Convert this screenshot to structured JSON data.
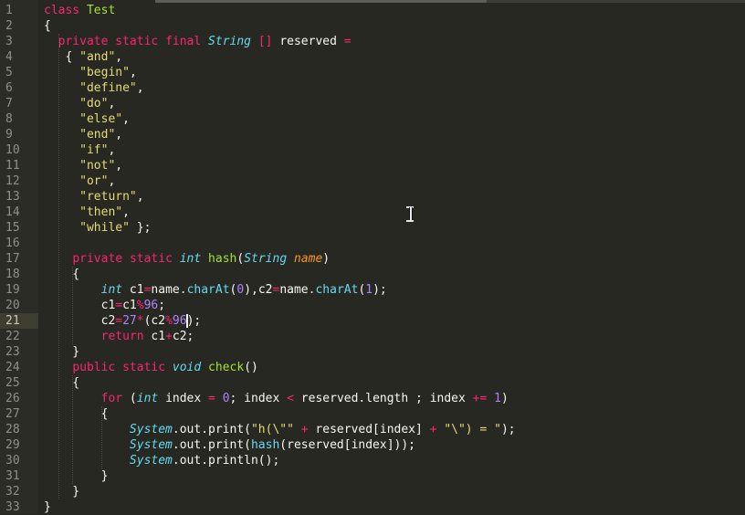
{
  "editor": {
    "theme_colors": {
      "background": "#272822",
      "keyword": "#f92672",
      "type": "#66d9ef",
      "function": "#a6e22e",
      "string": "#e6db74",
      "number": "#ae81ff",
      "parameter": "#fd971f",
      "text": "#f8f8f2",
      "line_number": "#8f908a"
    },
    "active_line": 21,
    "lines": [
      {
        "n": "1",
        "tokens": [
          [
            "kw",
            "class"
          ],
          [
            "pl",
            " "
          ],
          [
            "fn",
            "Test"
          ]
        ]
      },
      {
        "n": "2",
        "tokens": [
          [
            "pl",
            "{"
          ]
        ]
      },
      {
        "n": "3",
        "tokens": [
          [
            "pl",
            "  "
          ],
          [
            "kw",
            "private"
          ],
          [
            "pl",
            " "
          ],
          [
            "kw",
            "static"
          ],
          [
            "pl",
            " "
          ],
          [
            "kw",
            "final"
          ],
          [
            "pl",
            " "
          ],
          [
            "ty",
            "String"
          ],
          [
            "pl",
            " "
          ],
          [
            "op",
            "[]"
          ],
          [
            "pl",
            " reserved "
          ],
          [
            "op",
            "="
          ]
        ]
      },
      {
        "n": "4",
        "tokens": [
          [
            "pl",
            "   { "
          ],
          [
            "st",
            "\"and\""
          ],
          [
            "pl",
            ","
          ]
        ]
      },
      {
        "n": "5",
        "tokens": [
          [
            "pl",
            "     "
          ],
          [
            "st",
            "\"begin\""
          ],
          [
            "pl",
            ","
          ]
        ]
      },
      {
        "n": "6",
        "tokens": [
          [
            "pl",
            "     "
          ],
          [
            "st",
            "\"define\""
          ],
          [
            "pl",
            ","
          ]
        ]
      },
      {
        "n": "7",
        "tokens": [
          [
            "pl",
            "     "
          ],
          [
            "st",
            "\"do\""
          ],
          [
            "pl",
            ","
          ]
        ]
      },
      {
        "n": "8",
        "tokens": [
          [
            "pl",
            "     "
          ],
          [
            "st",
            "\"else\""
          ],
          [
            "pl",
            ","
          ]
        ]
      },
      {
        "n": "9",
        "tokens": [
          [
            "pl",
            "     "
          ],
          [
            "st",
            "\"end\""
          ],
          [
            "pl",
            ","
          ]
        ]
      },
      {
        "n": "10",
        "tokens": [
          [
            "pl",
            "     "
          ],
          [
            "st",
            "\"if\""
          ],
          [
            "pl",
            ","
          ]
        ]
      },
      {
        "n": "11",
        "tokens": [
          [
            "pl",
            "     "
          ],
          [
            "st",
            "\"not\""
          ],
          [
            "pl",
            ","
          ]
        ]
      },
      {
        "n": "12",
        "tokens": [
          [
            "pl",
            "     "
          ],
          [
            "st",
            "\"or\""
          ],
          [
            "pl",
            ","
          ]
        ]
      },
      {
        "n": "13",
        "tokens": [
          [
            "pl",
            "     "
          ],
          [
            "st",
            "\"return\""
          ],
          [
            "pl",
            ","
          ]
        ]
      },
      {
        "n": "14",
        "tokens": [
          [
            "pl",
            "     "
          ],
          [
            "st",
            "\"then\""
          ],
          [
            "pl",
            ","
          ]
        ]
      },
      {
        "n": "15",
        "tokens": [
          [
            "pl",
            "     "
          ],
          [
            "st",
            "\"while\""
          ],
          [
            "pl",
            " };"
          ]
        ]
      },
      {
        "n": "16",
        "tokens": []
      },
      {
        "n": "17",
        "tokens": [
          [
            "pl",
            "    "
          ],
          [
            "kw",
            "private"
          ],
          [
            "pl",
            " "
          ],
          [
            "kw",
            "static"
          ],
          [
            "pl",
            " "
          ],
          [
            "ty",
            "int"
          ],
          [
            "pl",
            " "
          ],
          [
            "fn",
            "hash"
          ],
          [
            "pl",
            "("
          ],
          [
            "ty",
            "String"
          ],
          [
            "pl",
            " "
          ],
          [
            "pa",
            "name"
          ],
          [
            "pl",
            ")"
          ]
        ]
      },
      {
        "n": "18",
        "tokens": [
          [
            "pl",
            "    {"
          ]
        ]
      },
      {
        "n": "19",
        "tokens": [
          [
            "pl",
            "        "
          ],
          [
            "ty",
            "int"
          ],
          [
            "pl",
            " c1"
          ],
          [
            "op",
            "="
          ],
          [
            "pl",
            "name."
          ],
          [
            "me",
            "charAt"
          ],
          [
            "pl",
            "("
          ],
          [
            "nu",
            "0"
          ],
          [
            "pl",
            "),c2"
          ],
          [
            "op",
            "="
          ],
          [
            "pl",
            "name."
          ],
          [
            "me",
            "charAt"
          ],
          [
            "pl",
            "("
          ],
          [
            "nu",
            "1"
          ],
          [
            "pl",
            ");"
          ]
        ]
      },
      {
        "n": "20",
        "tokens": [
          [
            "pl",
            "        c1"
          ],
          [
            "op",
            "="
          ],
          [
            "pl",
            "c1"
          ],
          [
            "op",
            "%"
          ],
          [
            "nu",
            "96"
          ],
          [
            "pl",
            ";"
          ]
        ]
      },
      {
        "n": "21",
        "tokens": [
          [
            "pl",
            "        c2"
          ],
          [
            "op",
            "="
          ],
          [
            "nu",
            "27"
          ],
          [
            "op",
            "*"
          ],
          [
            "pl",
            "(c2"
          ],
          [
            "op",
            "%"
          ],
          [
            "nu",
            "96"
          ],
          [
            "pl",
            ");"
          ]
        ]
      },
      {
        "n": "22",
        "tokens": [
          [
            "pl",
            "        "
          ],
          [
            "kw",
            "return"
          ],
          [
            "pl",
            " c1"
          ],
          [
            "op",
            "+"
          ],
          [
            "pl",
            "c2;"
          ]
        ]
      },
      {
        "n": "23",
        "tokens": [
          [
            "pl",
            "    }"
          ]
        ]
      },
      {
        "n": "24",
        "tokens": [
          [
            "pl",
            "    "
          ],
          [
            "kw",
            "public"
          ],
          [
            "pl",
            " "
          ],
          [
            "kw",
            "static"
          ],
          [
            "pl",
            " "
          ],
          [
            "ty",
            "void"
          ],
          [
            "pl",
            " "
          ],
          [
            "fn",
            "check"
          ],
          [
            "pl",
            "()"
          ]
        ]
      },
      {
        "n": "25",
        "tokens": [
          [
            "pl",
            "    {"
          ]
        ]
      },
      {
        "n": "26",
        "tokens": [
          [
            "pl",
            "        "
          ],
          [
            "kw",
            "for"
          ],
          [
            "pl",
            " ("
          ],
          [
            "ty",
            "int"
          ],
          [
            "pl",
            " index "
          ],
          [
            "op",
            "="
          ],
          [
            "pl",
            " "
          ],
          [
            "nu",
            "0"
          ],
          [
            "pl",
            "; index "
          ],
          [
            "op",
            "<"
          ],
          [
            "pl",
            " reserved.length ; index "
          ],
          [
            "op",
            "+="
          ],
          [
            "pl",
            " "
          ],
          [
            "nu",
            "1"
          ],
          [
            "pl",
            ")"
          ]
        ]
      },
      {
        "n": "27",
        "tokens": [
          [
            "pl",
            "        {"
          ]
        ]
      },
      {
        "n": "28",
        "tokens": [
          [
            "pl",
            "            "
          ],
          [
            "cl",
            "System"
          ],
          [
            "pl",
            ".out.print("
          ],
          [
            "st",
            "\"h(\\\"\""
          ],
          [
            "pl",
            " "
          ],
          [
            "op",
            "+"
          ],
          [
            "pl",
            " reserved[index] "
          ],
          [
            "op",
            "+"
          ],
          [
            "pl",
            " "
          ],
          [
            "st",
            "\"\\\") = \""
          ],
          [
            "pl",
            ");"
          ]
        ]
      },
      {
        "n": "29",
        "tokens": [
          [
            "pl",
            "            "
          ],
          [
            "cl",
            "System"
          ],
          [
            "pl",
            ".out.print("
          ],
          [
            "me",
            "hash"
          ],
          [
            "pl",
            "(reserved[index]));"
          ]
        ]
      },
      {
        "n": "30",
        "tokens": [
          [
            "pl",
            "            "
          ],
          [
            "cl",
            "System"
          ],
          [
            "pl",
            ".out.println();"
          ]
        ]
      },
      {
        "n": "31",
        "tokens": [
          [
            "pl",
            "        }"
          ]
        ]
      },
      {
        "n": "32",
        "tokens": [
          [
            "pl",
            "    }"
          ]
        ]
      },
      {
        "n": "33",
        "tokens": [
          [
            "pl",
            "}"
          ]
        ]
      }
    ]
  }
}
